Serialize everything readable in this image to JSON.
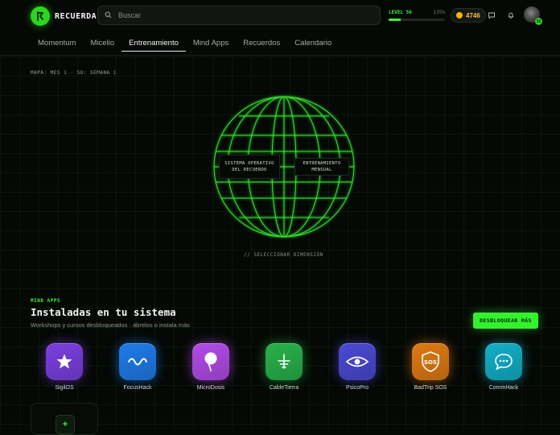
{
  "header": {
    "app_name": "RECUERDA",
    "search_placeholder": "Buscar",
    "level_label": "LEVEL 56",
    "xp_text": "135%",
    "level_progress": 0.22,
    "coins": "4746",
    "avatar_badge": "56"
  },
  "tabs": [
    {
      "label": "Momentum"
    },
    {
      "label": "Micelio"
    },
    {
      "label": "Entrenamiento"
    },
    {
      "label": "Mind Apps"
    },
    {
      "label": "Recuerdos"
    },
    {
      "label": "Calendario"
    }
  ],
  "active_tab": "Entrenamiento",
  "map": {
    "label": "MAPA: MES 1 · SO: SEMANA 1",
    "globe_left": "SISTEMA OPERATIVO DEL RECUERDO",
    "globe_right": "ENTRENAMIENTO MENSUAL",
    "select_hint": "// SELECCIONAR DIMENSIÓN"
  },
  "mind_apps": {
    "eyebrow": "MIND APPS",
    "title": "Instaladas en tu sistema",
    "subtitle": "Workshops y cursos desbloqueados · ábrelos o instala más",
    "unlock_label": "DESBLOQUEAR MÁS",
    "apps": [
      {
        "name": "SigilOS",
        "icon": "star-icon",
        "color": "#7b3fe0"
      },
      {
        "name": "FocusHack",
        "icon": "wave-icon",
        "color": "#1f7bea"
      },
      {
        "name": "MicroDosis",
        "icon": "drop-icon",
        "color": "#b24be8"
      },
      {
        "name": "CableTierra",
        "icon": "ground-icon",
        "color": "#28b24a"
      },
      {
        "name": "PsicoPro",
        "icon": "eye-icon",
        "color": "#4a4ad4"
      },
      {
        "name": "BadTrip SOS",
        "icon": "shield-sos-icon",
        "color": "#e07a12"
      },
      {
        "name": "CommHack",
        "icon": "chat-icon",
        "color": "#12b0c8"
      }
    ],
    "add_label": "+"
  },
  "colors": {
    "accent": "#33f22d",
    "coin": "#f4b400"
  }
}
